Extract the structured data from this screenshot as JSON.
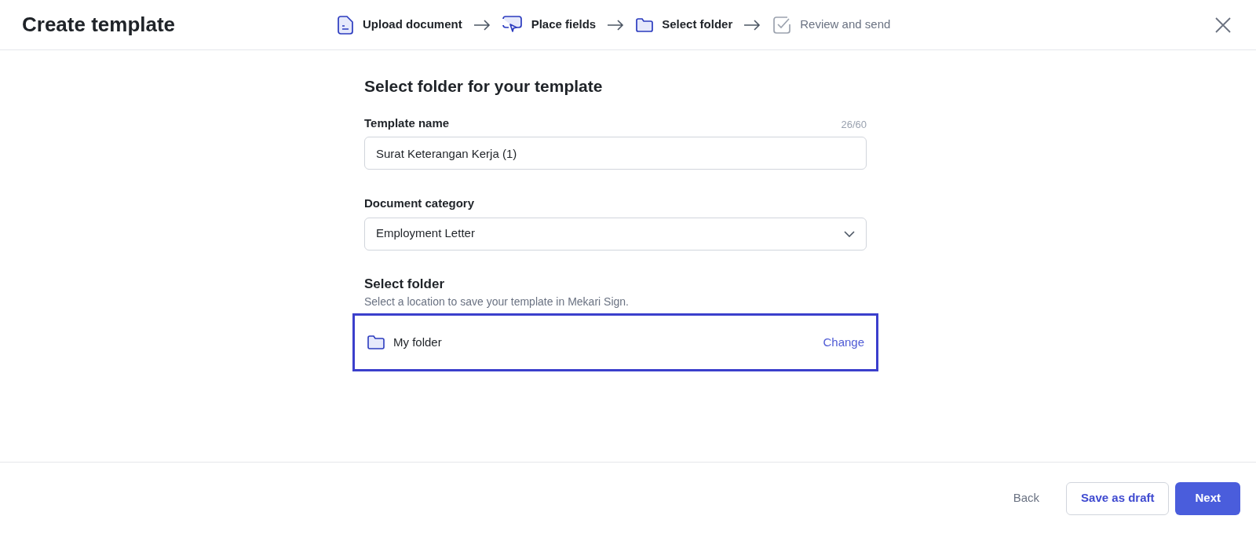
{
  "header": {
    "title": "Create template",
    "steps": [
      {
        "label": "Upload document",
        "kind": "document",
        "active": true
      },
      {
        "label": "Place fields",
        "kind": "cursor",
        "active": true
      },
      {
        "label": "Select folder",
        "kind": "folder",
        "active": true
      },
      {
        "label": "Review and send",
        "kind": "check",
        "active": false
      }
    ]
  },
  "form": {
    "heading": "Select folder for your template",
    "template_name": {
      "label": "Template name",
      "counter": "26/60",
      "value": "Surat Keterangan Kerja (1)"
    },
    "document_category": {
      "label": "Document category",
      "value": "Employment Letter"
    },
    "folder": {
      "heading": "Select folder",
      "description": "Select a location to save your template in Mekari Sign.",
      "name": "My folder",
      "action": "Change",
      "highlighted": true
    }
  },
  "footer": {
    "back": "Back",
    "save_draft": "Save as draft",
    "next": "Next"
  }
}
